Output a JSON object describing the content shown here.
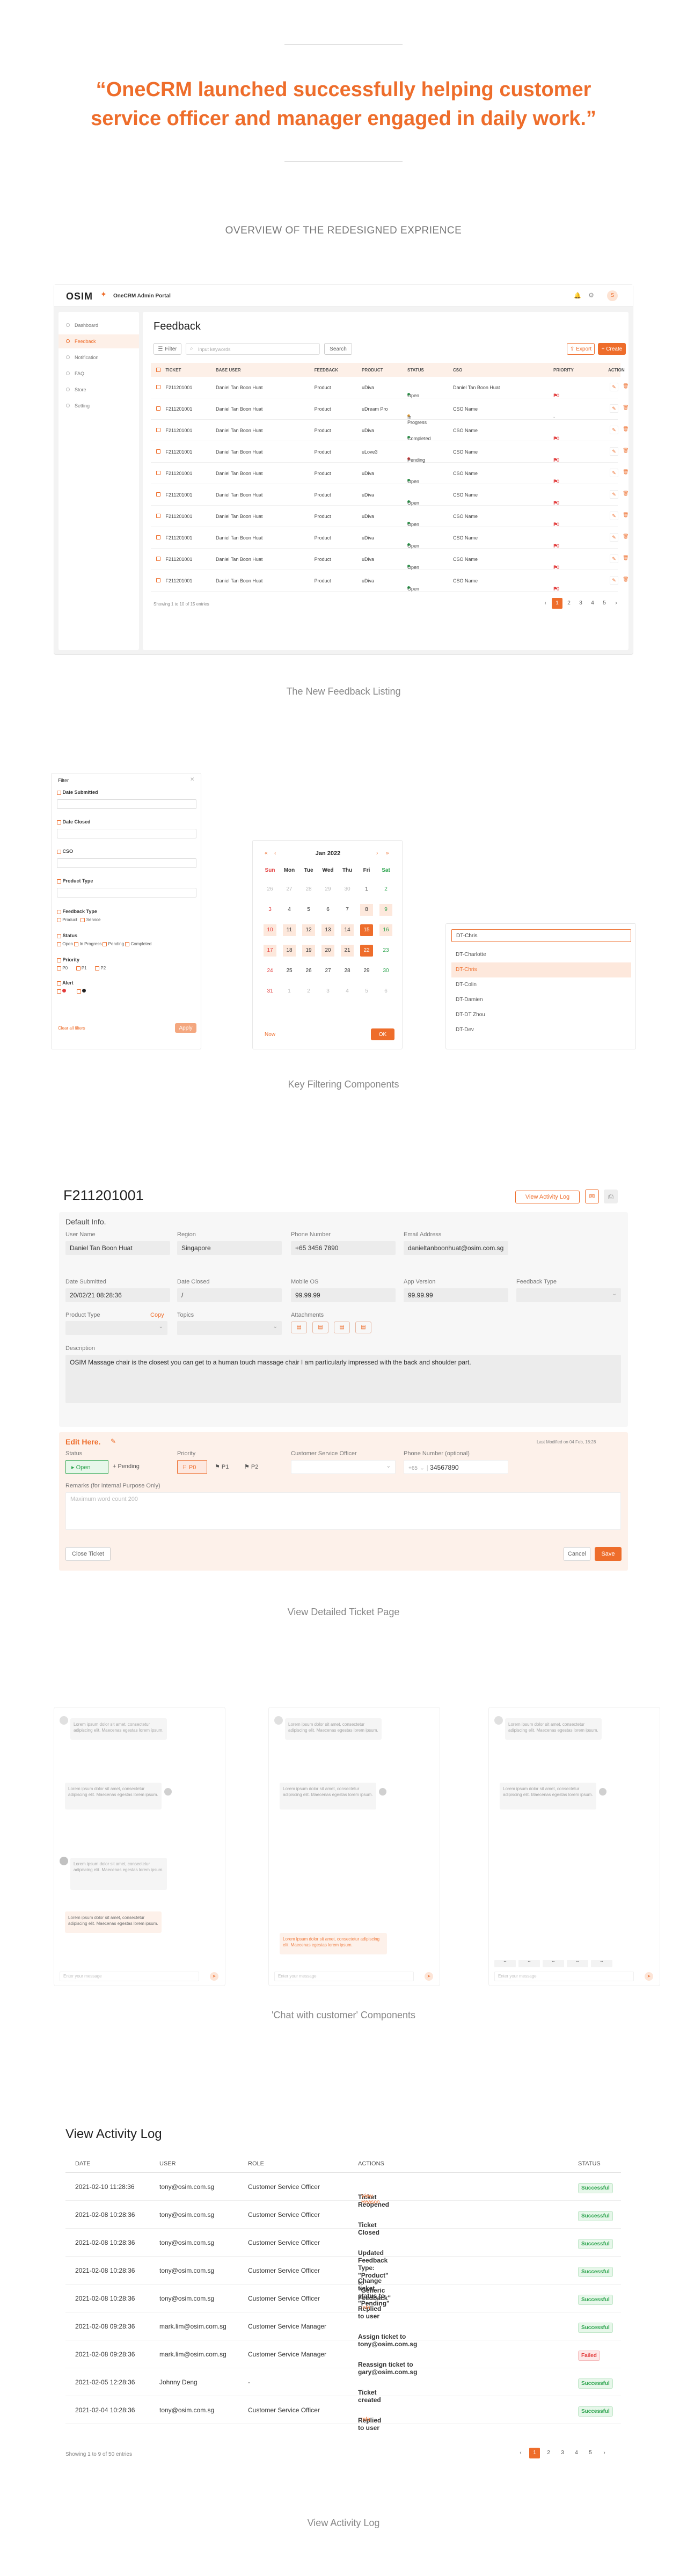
{
  "quote": "“OneCRM launched successfully helping customer service officer and manager engaged in daily work.”",
  "overview_title": "OVERVIEW OF THE REDESIGNED EXPRIENCE",
  "captions": {
    "listing": "The New Feedback Listing",
    "filters": "Key Filtering Components",
    "ticket": "View Detailed Ticket Page",
    "chat": "'Chat with customer' Components",
    "activity": "View Activity Log"
  },
  "app": {
    "logo": "OSIM",
    "portal": "OneCRM Admin Portal",
    "avatar_initial": "S",
    "sidebar": [
      "Dashboard",
      "Feedback",
      "Notification",
      "FAQ",
      "Store",
      "Setting"
    ],
    "page_title": "Feedback",
    "filter_label": "Filter",
    "search_placeholder": "Input keywords",
    "search_btn": "Search",
    "export_btn": "Export",
    "create_btn": "+ Create",
    "columns": [
      "TICKET",
      "BASE USER",
      "FEEDBACK",
      "PRODUCT",
      "STATUS",
      "CSO",
      "PRIORITY",
      "ACTION"
    ],
    "rows": [
      {
        "ticket": "F211201001",
        "user": "Daniel Tan Boon Huat",
        "feedback": "Product",
        "product": "uDiva",
        "status": "Open",
        "status_color": "#2da44e",
        "cso": "Daniel Tan Boon Huat",
        "priority": "P0"
      },
      {
        "ticket": "F211201001",
        "user": "Daniel Tan Boon Huat",
        "feedback": "Product",
        "product": "uDream Pro",
        "status": "In Progress",
        "status_color": "#e8a33b",
        "cso": "CSO Name",
        "priority": "-"
      },
      {
        "ticket": "F211201001",
        "user": "Daniel Tan Boon Huat",
        "feedback": "Product",
        "product": "uDiva",
        "status": "Completed",
        "status_color": "#2da44e",
        "cso": "CSO Name",
        "priority": "P0"
      },
      {
        "ticket": "F211201001",
        "user": "Daniel Tan Boon Huat",
        "feedback": "Product",
        "product": "uLove3",
        "status": "Pending",
        "status_color": "#e23c3c",
        "cso": "CSO Name",
        "priority": "P0"
      },
      {
        "ticket": "F211201001",
        "user": "Daniel Tan Boon Huat",
        "feedback": "Product",
        "product": "uDiva",
        "status": "Open",
        "status_color": "#2da44e",
        "cso": "CSO Name",
        "priority": "P0"
      },
      {
        "ticket": "F211201001",
        "user": "Daniel Tan Boon Huat",
        "feedback": "Product",
        "product": "uDiva",
        "status": "Open",
        "status_color": "#2da44e",
        "cso": "CSO Name",
        "priority": "P0"
      },
      {
        "ticket": "F211201001",
        "user": "Daniel Tan Boon Huat",
        "feedback": "Product",
        "product": "uDiva",
        "status": "Open",
        "status_color": "#2da44e",
        "cso": "CSO Name",
        "priority": "P0"
      },
      {
        "ticket": "F211201001",
        "user": "Daniel Tan Boon Huat",
        "feedback": "Product",
        "product": "uDiva",
        "status": "Open",
        "status_color": "#2da44e",
        "cso": "CSO Name",
        "priority": "P0"
      },
      {
        "ticket": "F211201001",
        "user": "Daniel Tan Boon Huat",
        "feedback": "Product",
        "product": "uDiva",
        "status": "Open",
        "status_color": "#2da44e",
        "cso": "CSO Name",
        "priority": "P0"
      },
      {
        "ticket": "F211201001",
        "user": "Daniel Tan Boon Huat",
        "feedback": "Product",
        "product": "uDiva",
        "status": "Open",
        "status_color": "#2da44e",
        "cso": "CSO Name",
        "priority": "P0"
      }
    ],
    "showing": "Showing 1 to 10 of 15 entries",
    "pages": [
      "1",
      "2",
      "3",
      "4",
      "5"
    ]
  },
  "filters": {
    "filter_title": "Filter",
    "date_submitted": "Date Submitted",
    "date_closed": "Date Closed",
    "cso": "CSO",
    "product_type": "Product Type",
    "feedback_type": "Feedback Type",
    "feedback_opts": [
      "Product",
      "Service"
    ],
    "status": "Status",
    "status_opts": [
      "Open",
      "In Progress",
      "Pending",
      "Completed"
    ],
    "priority": "Priority",
    "priority_opts": [
      "P0",
      "P1",
      "P2"
    ],
    "alert": "Alert",
    "clear_all": "Clear all filters",
    "apply": "Apply",
    "calendar": {
      "month": "Jan 2022",
      "days": [
        "Sun",
        "Mon",
        "Tue",
        "Wed",
        "Thu",
        "Fri",
        "Sat"
      ],
      "dates": [
        "26",
        "27",
        "28",
        "29",
        "30",
        "1",
        "2",
        "3",
        "4",
        "5",
        "6",
        "7",
        "8",
        "9",
        "10",
        "11",
        "12",
        "13",
        "14",
        "15",
        "16",
        "17",
        "18",
        "19",
        "20",
        "21",
        "22",
        "23",
        "24",
        "25",
        "26",
        "27",
        "28",
        "29",
        "30",
        "31",
        "1",
        "2",
        "3",
        "4",
        "5",
        "6"
      ],
      "now": "Now",
      "ok": "OK"
    },
    "cso_search": "DT-Chris",
    "cso_list": [
      "DT-Charlotte",
      "DT-Chris",
      "DT-Colin",
      "DT-Damien",
      "DT-DT Zhou",
      "DT-Dev"
    ]
  },
  "ticket": {
    "id": "F211201001",
    "activity_btn": "View Activity Log",
    "default_info": "Default Info.",
    "fields": [
      {
        "label": "User Name",
        "value": "Daniel Tan Boon Huat"
      },
      {
        "label": "Region",
        "value": "Singapore"
      },
      {
        "label": "Phone Number",
        "value": "+65 3456 7890"
      },
      {
        "label": "Email Address",
        "value": "danieltanboonhuat@osim.com.sg"
      },
      {
        "label": "Date Submitted",
        "value": "20/02/21 08:28:36"
      },
      {
        "label": "Date Closed",
        "value": "/"
      },
      {
        "label": "Mobile OS",
        "value": "99.99.99"
      },
      {
        "label": "App Version",
        "value": "99.99.99"
      }
    ],
    "feedback_type": "Feedback Type",
    "product_type": "Product Type",
    "copy": "Copy",
    "topics": "Topics",
    "attachments": "Attachments",
    "description_label": "Description",
    "description": "OSIM Massage chair is the closest you can get to a human touch massage chair I am particularly impressed with the back and shoulder part.",
    "edit_here": "Edit Here.",
    "last_modified": "Last Modified on 04 Feb, 18:28",
    "status_label": "Status",
    "status_open": "Open",
    "status_pending": "+ Pending",
    "priority_label": "Priority",
    "priority_opts": [
      "P0",
      "P1",
      "P2"
    ],
    "cso_label": "Customer Service Officer",
    "phone_label": "Phone Number (optional)",
    "phone_prefix": "+65",
    "phone_value": "34567890",
    "remarks_label": "Remarks (for Internal Purpose Only)",
    "remarks_placeholder": "Maximum word count 200",
    "close_ticket": "Close Ticket",
    "cancel": "Cancel",
    "save": "Save"
  },
  "chat": {
    "bubble_text": "Lorem ipsum dolor sit amet, consectetur adipiscing elit. Maecenas egestas lorem ipsum.",
    "input_placeholder": "Enter your message"
  },
  "activity": {
    "title": "View Activity Log",
    "columns": [
      "DATE",
      "USER",
      "ROLE",
      "ACTIONS",
      "STATUS"
    ],
    "rows": [
      {
        "date": "2021-02-10 11:28:36",
        "user": "tony@osim.com.sg",
        "role": "Customer Service Officer",
        "action": "Ticket Reopened",
        "extra": "View Reason",
        "status": "Successful",
        "ok": true
      },
      {
        "date": "2021-02-08 10:28:36",
        "user": "tony@osim.com.sg",
        "role": "Customer Service Officer",
        "action": "Ticket Closed",
        "extra": "",
        "status": "Successful",
        "ok": true
      },
      {
        "date": "2021-02-08 10:28:36",
        "user": "tony@osim.com.sg",
        "role": "Customer Service Officer",
        "action": "Updated Feedback Type: \"Product\" to \"Generic Feedback\"",
        "extra": "",
        "status": "Successful",
        "ok": true
      },
      {
        "date": "2021-02-08 10:28:36",
        "user": "tony@osim.com.sg",
        "role": "Customer Service Officer",
        "action": "Change ticket status to \"Pending\"",
        "extra": "",
        "status": "Successful",
        "ok": true
      },
      {
        "date": "2021-02-08 10:28:36",
        "user": "tony@osim.com.sg",
        "role": "Customer Service Officer",
        "action": "Replied to user",
        "extra": "Info",
        "status": "Successful",
        "ok": true
      },
      {
        "date": "2021-02-08 09:28:36",
        "user": "mark.lim@osim.com.sg",
        "role": "Customer Service Manager",
        "action": "Assign ticket to tony@osim.com.sg",
        "extra": "",
        "status": "Successful",
        "ok": true
      },
      {
        "date": "2021-02-08 09:28:36",
        "user": "mark.lim@osim.com.sg",
        "role": "Customer Service Manager",
        "action": "Reassign ticket to gary@osim.com.sg",
        "extra": "",
        "status": "Failed",
        "ok": false
      },
      {
        "date": "2021-02-05 12:28:36",
        "user": "Johnny Deng",
        "role": "-",
        "action": "Ticket created",
        "extra": "",
        "status": "Successful",
        "ok": true
      },
      {
        "date": "2021-02-04 10:28:36",
        "user": "tony@osim.com.sg",
        "role": "Customer Service Officer",
        "action": "Replied to user",
        "extra": "Info",
        "status": "Successful",
        "ok": true
      }
    ],
    "showing": "Showing 1 to 9 of 50 entries",
    "pages": [
      "1",
      "2",
      "3",
      "4",
      "5"
    ]
  },
  "colors": {
    "accent": "#ee6d2b",
    "success": "#2da44e",
    "danger": "#e23c3c"
  }
}
